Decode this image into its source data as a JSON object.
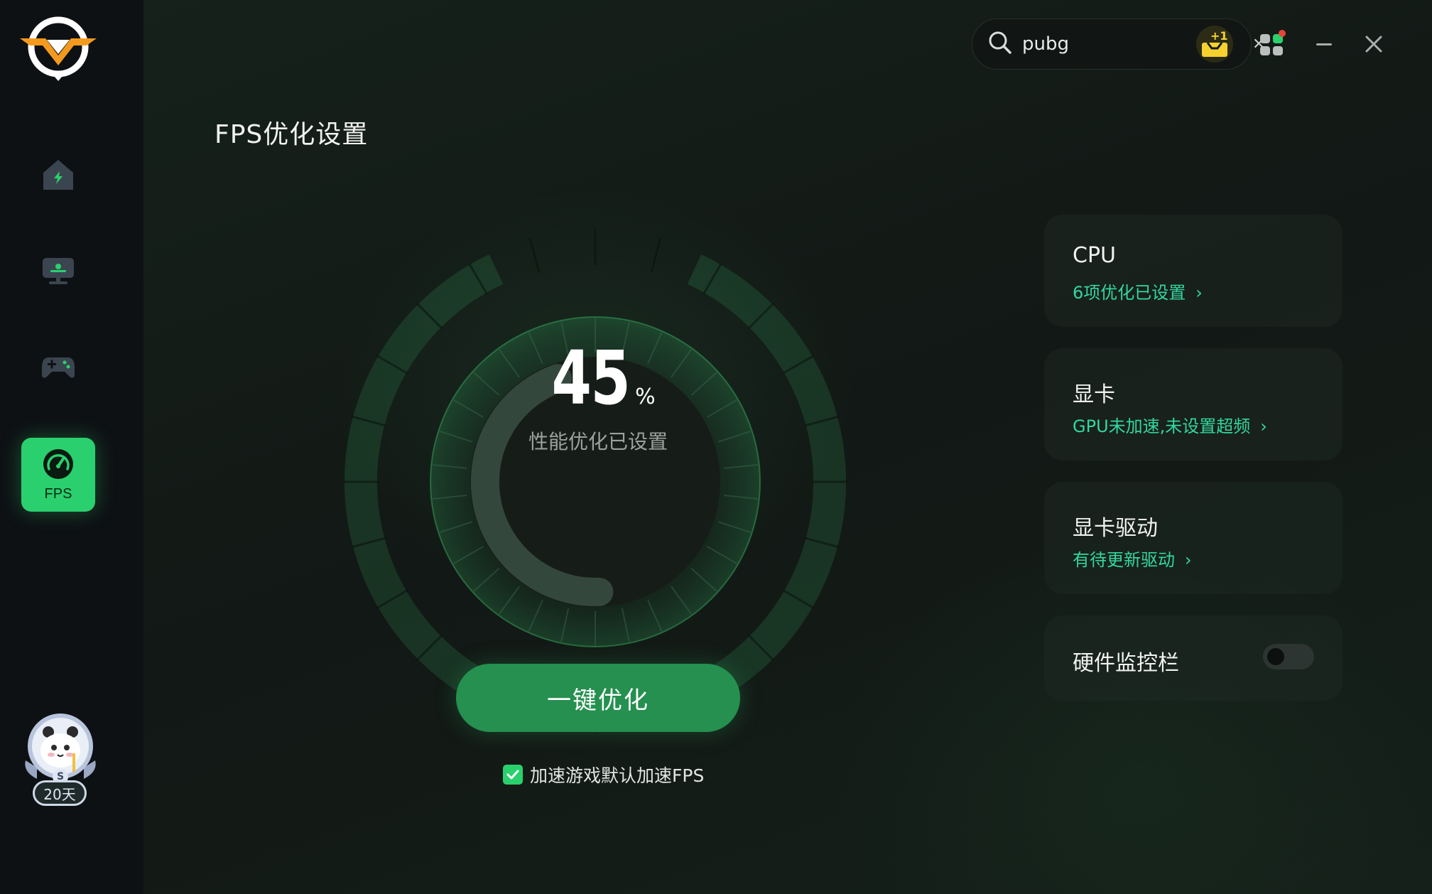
{
  "search": {
    "value": "pubg",
    "clear_icon": "✕"
  },
  "sidebar": {
    "fps_label": "FPS",
    "member_days": "20天",
    "member_badge": "S"
  },
  "topbar": {
    "gift_badge": "+1"
  },
  "page": {
    "title": "FPS优化设置"
  },
  "gauge": {
    "value": "45",
    "unit": "%",
    "subtitle": "性能优化已设置",
    "progress_fraction": 0.45
  },
  "actions": {
    "optimize_label": "一键优化",
    "auto_fps_label": "加速游戏默认加速FPS",
    "auto_fps_checked": true
  },
  "cards": {
    "cpu": {
      "title": "CPU",
      "link": "6项优化已设置"
    },
    "gpu": {
      "title": "显卡",
      "link": "GPU未加速,未设置超频"
    },
    "driver": {
      "title": "显卡驱动",
      "link": "有待更新驱动"
    },
    "monitor": {
      "title": "硬件监控栏",
      "enabled": false
    }
  },
  "colors": {
    "accent_green": "#2bd06e",
    "button_green": "#25904f",
    "link_teal": "#33d6a0",
    "badge_yellow": "#f6d230"
  }
}
